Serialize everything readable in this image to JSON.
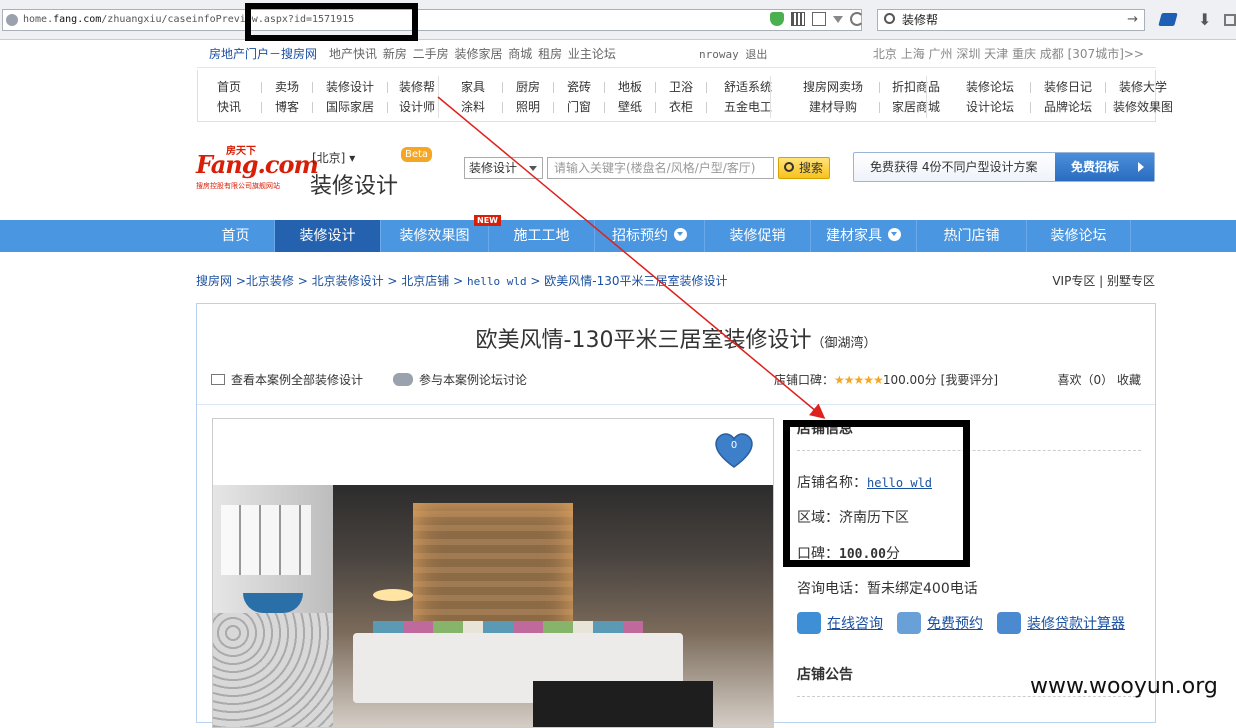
{
  "browser": {
    "url_prefix": "home.",
    "url_host": "fang.com",
    "url_rest": "/zhuangxiu/caseinfoPreview.aspx?id=1571915",
    "search_value": "装修帮"
  },
  "topnav": {
    "brand": "房地产门户－搜房网",
    "links": "地产快讯  新房  二手房  装修家居  商城  租房  业主论坛",
    "user": "nroway",
    "logout": "退出",
    "cities": "北京  上海  广州  深圳  天津  重庆  成都  [307城市]>>"
  },
  "menugrid": {
    "row1": [
      "首页",
      "卖场",
      "装修设计",
      "装修帮",
      "家具",
      "厨房",
      "瓷砖",
      "地板",
      "卫浴",
      "舒适系统",
      "搜房网卖场",
      "折扣商品",
      "装修论坛",
      "装修日记",
      "装修大学"
    ],
    "row2": [
      "快讯",
      "博客",
      "国际家居",
      "设计师",
      "涂料",
      "照明",
      "门窗",
      "壁纸",
      "衣柜",
      "五金电工",
      "建材导购",
      "家居商城",
      "设计论坛",
      "品牌论坛",
      "装修效果图"
    ]
  },
  "header": {
    "logo_top": "房天下",
    "logo_main": "Fang.com",
    "logo_sub": "搜房控股有限公司旗舰网站",
    "city": "[北京]",
    "channel": "装修设计",
    "beta": "Beta",
    "select": "装修设计",
    "placeholder": "请输入关键字(楼盘名/风格/户型/客厅)",
    "search_btn": "搜索",
    "promo_text": "免费获得 4份不同户型设计方案",
    "promo_btn": "免费招标"
  },
  "bluenav": {
    "items": [
      "首页",
      "装修设计",
      "装修效果图",
      "施工工地",
      "招标预约",
      "装修促销",
      "建材家具",
      "热门店铺",
      "装修论坛"
    ],
    "new": "NEW"
  },
  "breadcrumb": {
    "a": "搜房网",
    "b": ">北京装修",
    "c": "北京装修设计",
    "d": "北京店铺",
    "e": "hello wld",
    "f": "欧美风情-130平米三居室装修设计",
    "sep": " > ",
    "vip": "VIP专区 | 别墅专区"
  },
  "case": {
    "title": "欧美风情-130平米三居室装修设计",
    "subtitle": "（御湖湾）",
    "view_all": "查看本案例全部装修设计",
    "discuss": "参与本案例论坛讨论",
    "rating_label": "店铺口碑：",
    "stars": "★★★★★",
    "rating_value": "100.00分",
    "rate_link": "[我要评分]",
    "like": "喜欢（0）",
    "fav": "收藏",
    "heart_count": "0"
  },
  "shop": {
    "heading": "店铺信息",
    "name_label": "店铺名称：",
    "name": "hello wld",
    "area_label": "区域：",
    "area": "济南历下区",
    "rep_label": "口碑：",
    "rep": "100.00",
    "rep_unit": "分",
    "phone_label": "咨询电话：",
    "phone": "暂未绑定400电话",
    "cta1": "在线咨询",
    "cta2": "免费预约",
    "cta3": "装修贷款计算器",
    "notice": "店铺公告"
  },
  "watermark": "www.wooyun.org"
}
